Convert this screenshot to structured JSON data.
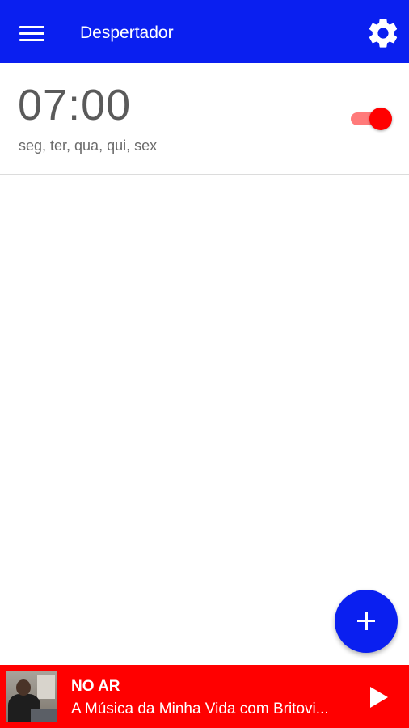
{
  "colors": {
    "app_bar": "#0a1ff0",
    "accent": "#ff0000",
    "fab": "#0a1ff0",
    "player_bar": "#ff0000"
  },
  "app_bar": {
    "menu_icon": "hamburger-menu-icon",
    "title": "Despertador",
    "settings_icon": "gear-icon"
  },
  "alarms": [
    {
      "time": "07:00",
      "days": "seg, ter, qua, qui, sex",
      "enabled": true
    }
  ],
  "fab": {
    "icon": "plus-icon"
  },
  "player": {
    "label": "NO AR",
    "track": "A Música da Minha Vida com Britovi...",
    "play_icon": "play-icon"
  }
}
